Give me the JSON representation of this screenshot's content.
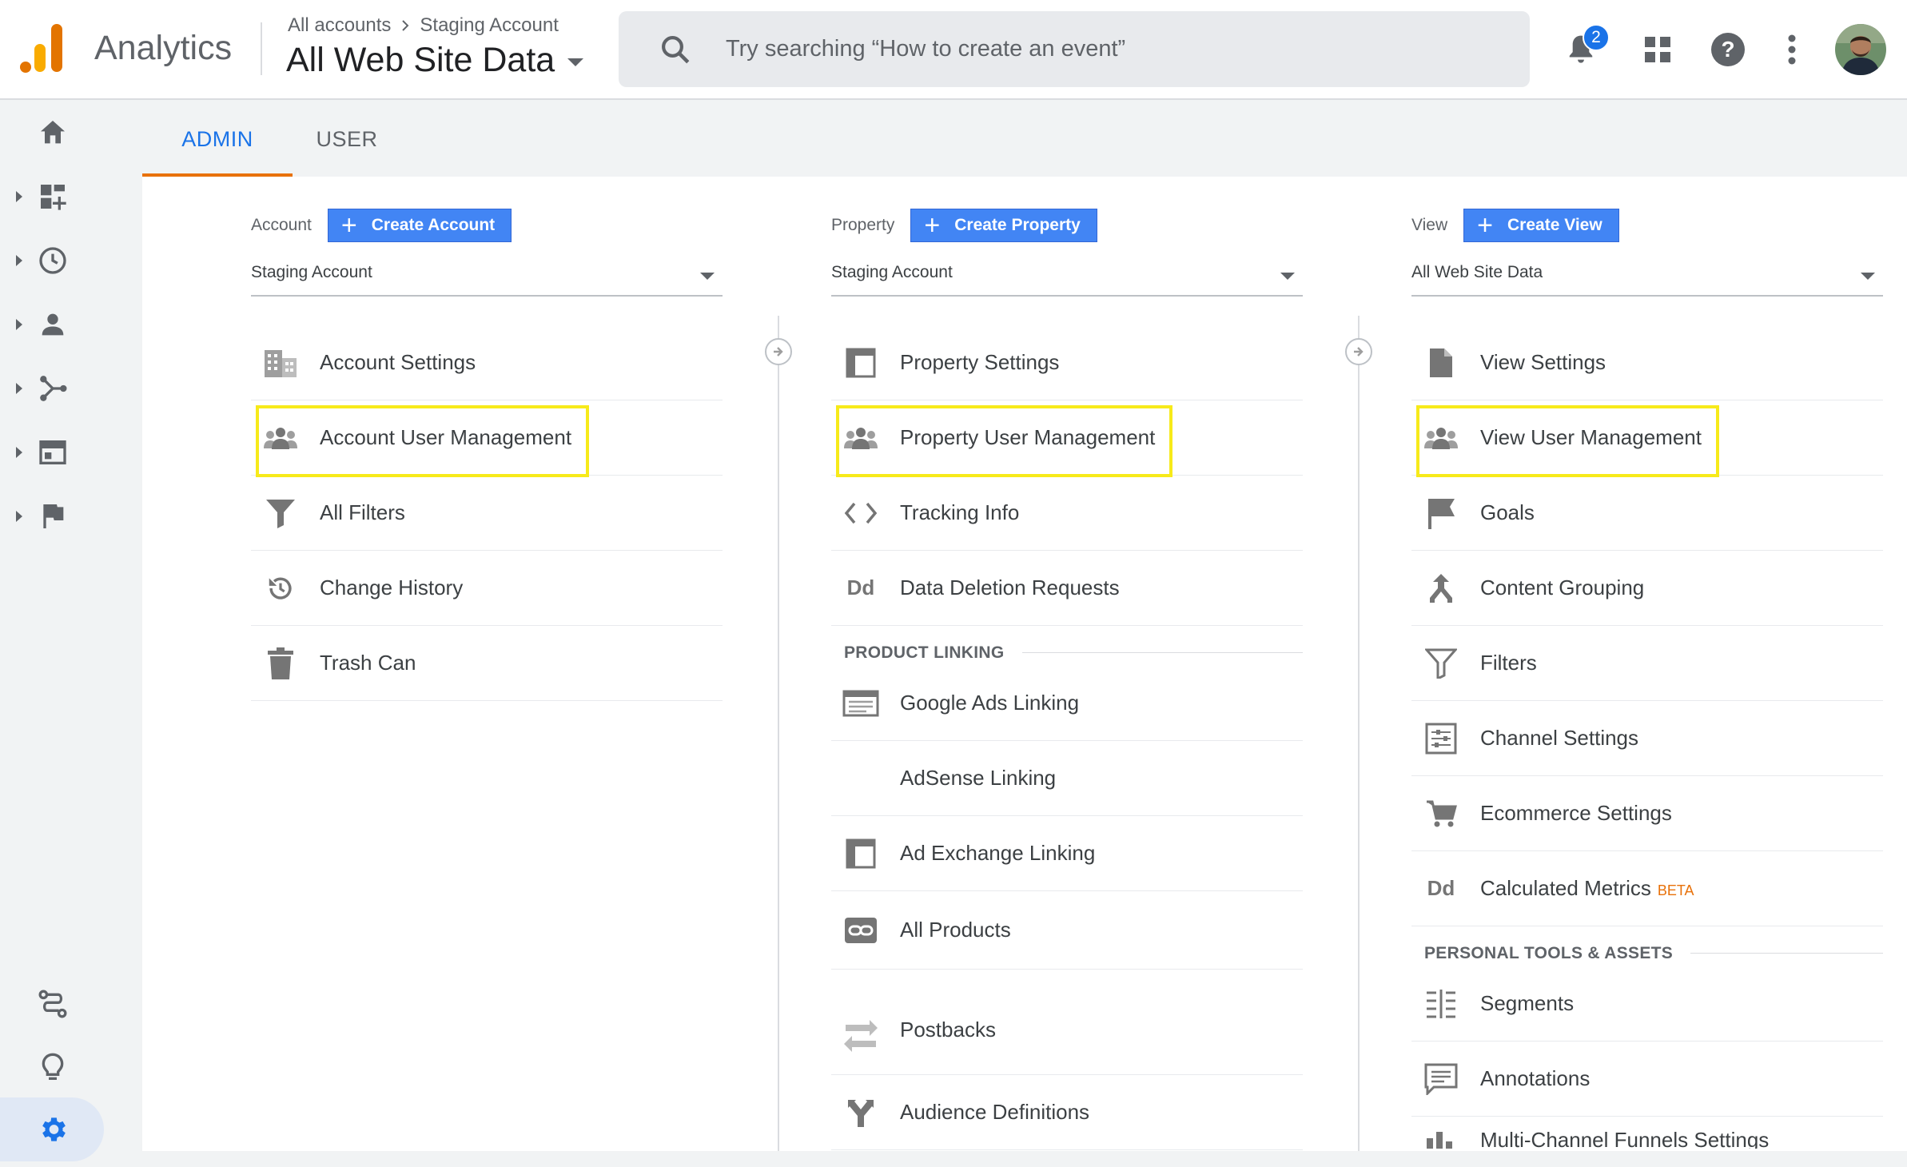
{
  "header": {
    "app_name": "Analytics",
    "breadcrumb": [
      "All accounts",
      "Staging Account"
    ],
    "view_title": "All Web Site Data",
    "search_placeholder": "Try searching “How to create an event”",
    "notification_count": "2"
  },
  "tabs": [
    "ADMIN",
    "USER"
  ],
  "account": {
    "label": "Account",
    "create_label": "Create Account",
    "selected": "Staging Account",
    "items": [
      "Account Settings",
      "Account User Management",
      "All Filters",
      "Change History",
      "Trash Can"
    ]
  },
  "property": {
    "label": "Property",
    "create_label": "Create Property",
    "selected": "Staging Account",
    "items": [
      "Property Settings",
      "Property User Management",
      "Tracking Info",
      "Data Deletion Requests"
    ],
    "product_linking_heading": "PRODUCT LINKING",
    "linking_items": [
      "Google Ads Linking",
      "AdSense Linking",
      "Ad Exchange Linking",
      "All Products",
      "Postbacks",
      "Audience Definitions"
    ]
  },
  "view": {
    "label": "View",
    "create_label": "Create View",
    "selected": "All Web Site Data",
    "items": [
      "View Settings",
      "View User Management",
      "Goals",
      "Content Grouping",
      "Filters",
      "Channel Settings",
      "Ecommerce Settings",
      "Calculated Metrics"
    ],
    "beta_label": "BETA",
    "personal_heading": "PERSONAL TOOLS & ASSETS",
    "personal_items": [
      "Segments",
      "Annotations",
      "Multi-Channel Funnels Settings"
    ]
  },
  "icon_glyphs": {
    "dd": "Dd"
  },
  "colors": {
    "accent_blue": "#1a73e8",
    "button_blue": "#4285f4",
    "tab_underline": "#e8710a",
    "highlight_yellow": "#f7ea1a",
    "logo_orange": "#f9ab00",
    "logo_dark_orange": "#e37400"
  }
}
